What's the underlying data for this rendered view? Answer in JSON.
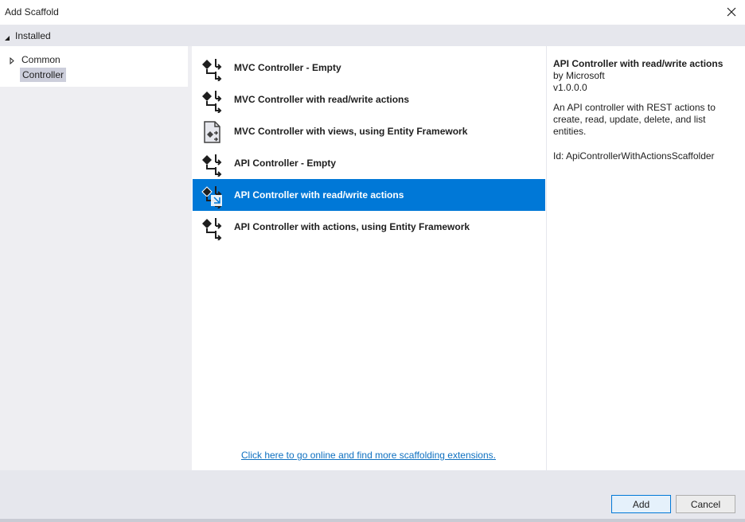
{
  "window": {
    "title": "Add Scaffold",
    "close_icon": "close-icon"
  },
  "installed": {
    "label": "Installed",
    "icon": "collapse-triangle-icon"
  },
  "tree": {
    "items": [
      {
        "label": "Common",
        "icon": "expand-triangle-icon",
        "selected": false
      },
      {
        "label": "Controller",
        "selected": true
      }
    ]
  },
  "scaffolds": {
    "items": [
      {
        "label": "MVC Controller - Empty",
        "icon": "controller-icon",
        "selected": false
      },
      {
        "label": "MVC Controller with read/write actions",
        "icon": "controller-icon",
        "selected": false
      },
      {
        "label": "MVC Controller with views, using Entity Framework",
        "icon": "controller-views-icon",
        "selected": false
      },
      {
        "label": "API Controller - Empty",
        "icon": "controller-icon",
        "selected": false
      },
      {
        "label": "API Controller with read/write actions",
        "icon": "controller-icon",
        "selected": true
      },
      {
        "label": "API Controller with actions, using Entity Framework",
        "icon": "controller-icon",
        "selected": false
      }
    ],
    "online_link": "Click here to go online and find more scaffolding extensions."
  },
  "details": {
    "title": "API Controller with read/write actions",
    "author": "by Microsoft",
    "version": "v1.0.0.0",
    "description": "An API controller with REST actions to create, read, update, delete, and list entities.",
    "id": "Id: ApiControllerWithActionsScaffolder"
  },
  "footer": {
    "add_label": "Add",
    "cancel_label": "Cancel"
  },
  "colors": {
    "accent": "#0078d7",
    "panel": "#e6e7ed",
    "link": "#0e70c0"
  }
}
